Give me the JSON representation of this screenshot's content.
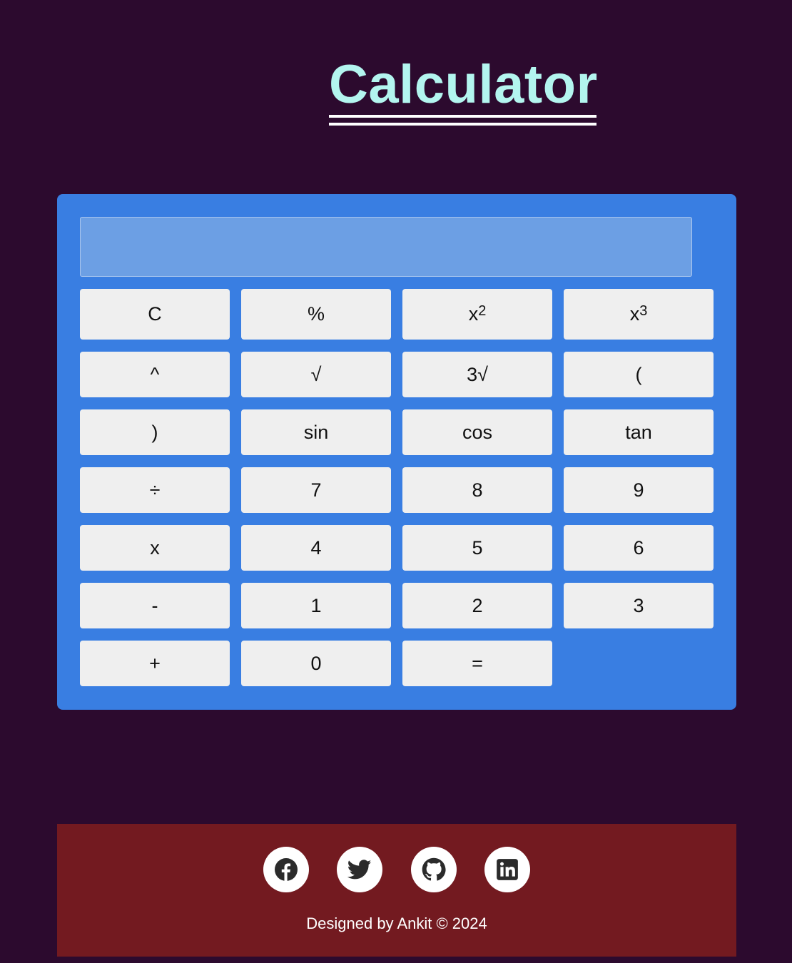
{
  "header": {
    "title": "Calculator"
  },
  "calculator": {
    "display_value": "",
    "keys": {
      "clear": "C",
      "percent": "%",
      "square_base": "x",
      "square_exp": "2",
      "cube_base": "x",
      "cube_exp": "3",
      "power": "^",
      "sqrt": "√",
      "cbrt": "3√",
      "open_paren": "(",
      "close_paren": ")",
      "sin": "sin",
      "cos": "cos",
      "tan": "tan",
      "divide": "÷",
      "seven": "7",
      "eight": "8",
      "nine": "9",
      "multiply": "x",
      "four": "4",
      "five": "5",
      "six": "6",
      "minus": "-",
      "one": "1",
      "two": "2",
      "three": "3",
      "plus": "+",
      "zero": "0",
      "equals": "="
    }
  },
  "footer": {
    "social_icons": [
      "facebook-icon",
      "twitter-icon",
      "github-icon",
      "linkedin-icon"
    ],
    "credit": "Designed by Ankit © 2024"
  },
  "colors": {
    "background": "#2c0a2e",
    "title": "#b3f5ef",
    "calculator_body": "#397ee2",
    "display": "#6c9fe4",
    "key": "#efefef",
    "footer": "#731a20"
  }
}
